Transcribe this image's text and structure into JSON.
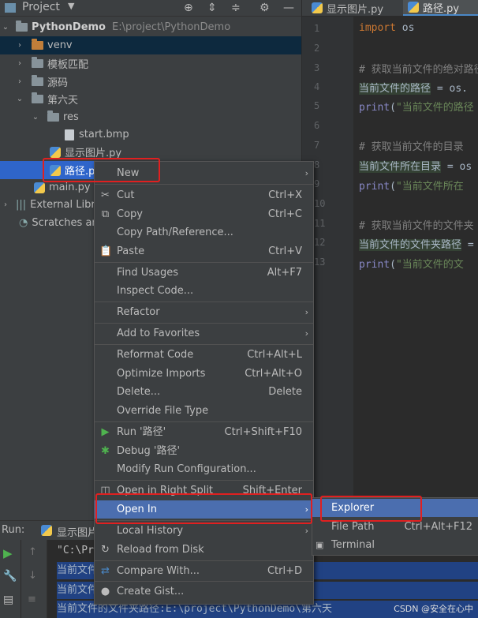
{
  "project_header": {
    "title": "Project",
    "icons": [
      "target-icon",
      "collapse-icon",
      "expand-icon",
      "gear-icon",
      "minimize-icon"
    ]
  },
  "tree": {
    "root": {
      "name": "PythonDemo",
      "path": "E:\\project\\PythonDemo"
    },
    "venv": "venv",
    "templates": "模板匹配",
    "source": "源码",
    "day6": "第六天",
    "res": "res",
    "start_bmp": "start.bmp",
    "show_py": "显示图片.py",
    "path_py": "路径.py",
    "main_py": "main.py",
    "external": "External Libraries",
    "scratches": "Scratches and Consoles"
  },
  "tabs": [
    {
      "label": "显示图片.py"
    },
    {
      "label": "路径.py"
    }
  ],
  "code": {
    "line_numbers": [
      "1",
      "2",
      "3",
      "4",
      "5",
      "6",
      "7",
      "8",
      "9",
      "10",
      "11",
      "12",
      "13"
    ],
    "l1_kw": "import",
    "l1_rest": " os",
    "l3": "# 获取当前文件的绝对路径",
    "l4_var": "当前文件的路径",
    "l4_rest": " = os.",
    "l5_fn": "print",
    "l5_rest": "(",
    "l5_str": "\"当前文件的路径",
    "l7": "# 获取当前文件的目录",
    "l8_var": "当前文件所在目录",
    "l8_rest": " = os",
    "l9_fn": "print",
    "l9_rest": "(",
    "l9_str": "\"当前文件所在",
    "l11": "# 获取当前文件的文件夹",
    "l12_var": "当前文件的文件夹路径",
    "l12_rest": " = ",
    "l13_fn": "print",
    "l13_rest": "(",
    "l13_str": "\"当前文件的文"
  },
  "run": {
    "label": "Run:",
    "tab": "显示图片",
    "out0": "\"C:\\Pr                                E:/project/PythonDemo",
    "out1": "当前文件                                  六天\\路径.py",
    "out2": "当前文件                                 /第六天",
    "out3": "当前文件的文件夹路径:E:\\project\\PythonDemo\\第六天"
  },
  "context_menu": {
    "new": "New",
    "cut": "Cut",
    "cut_sc": "Ctrl+X",
    "copy": "Copy",
    "copy_sc": "Ctrl+C",
    "copy_path": "Copy Path/Reference...",
    "paste": "Paste",
    "paste_sc": "Ctrl+V",
    "find_usages": "Find Usages",
    "find_usages_sc": "Alt+F7",
    "inspect": "Inspect Code...",
    "refactor": "Refactor",
    "add_fav": "Add to Favorites",
    "reformat": "Reformat Code",
    "reformat_sc": "Ctrl+Alt+L",
    "optimize": "Optimize Imports",
    "optimize_sc": "Ctrl+Alt+O",
    "delete": "Delete...",
    "delete_sc": "Delete",
    "override": "Override File Type",
    "run": "Run '路径'",
    "run_sc": "Ctrl+Shift+F10",
    "debug": "Debug '路径'",
    "modify": "Modify Run Configuration...",
    "open_right": "Open in Right Split",
    "open_right_sc": "Shift+Enter",
    "open_in": "Open In",
    "local_history": "Local History",
    "reload": "Reload from Disk",
    "compare": "Compare With...",
    "compare_sc": "Ctrl+D",
    "gist": "Create Gist..."
  },
  "submenu": {
    "explorer": "Explorer",
    "file_path": "File Path",
    "file_path_sc": "Ctrl+Alt+F12",
    "terminal": "Terminal"
  },
  "watermark": "CSDN @安全在心中",
  "colors": {
    "menu_bg": "#3c3f41",
    "highlight": "#4b6eaf",
    "annotation": "#e02020"
  }
}
